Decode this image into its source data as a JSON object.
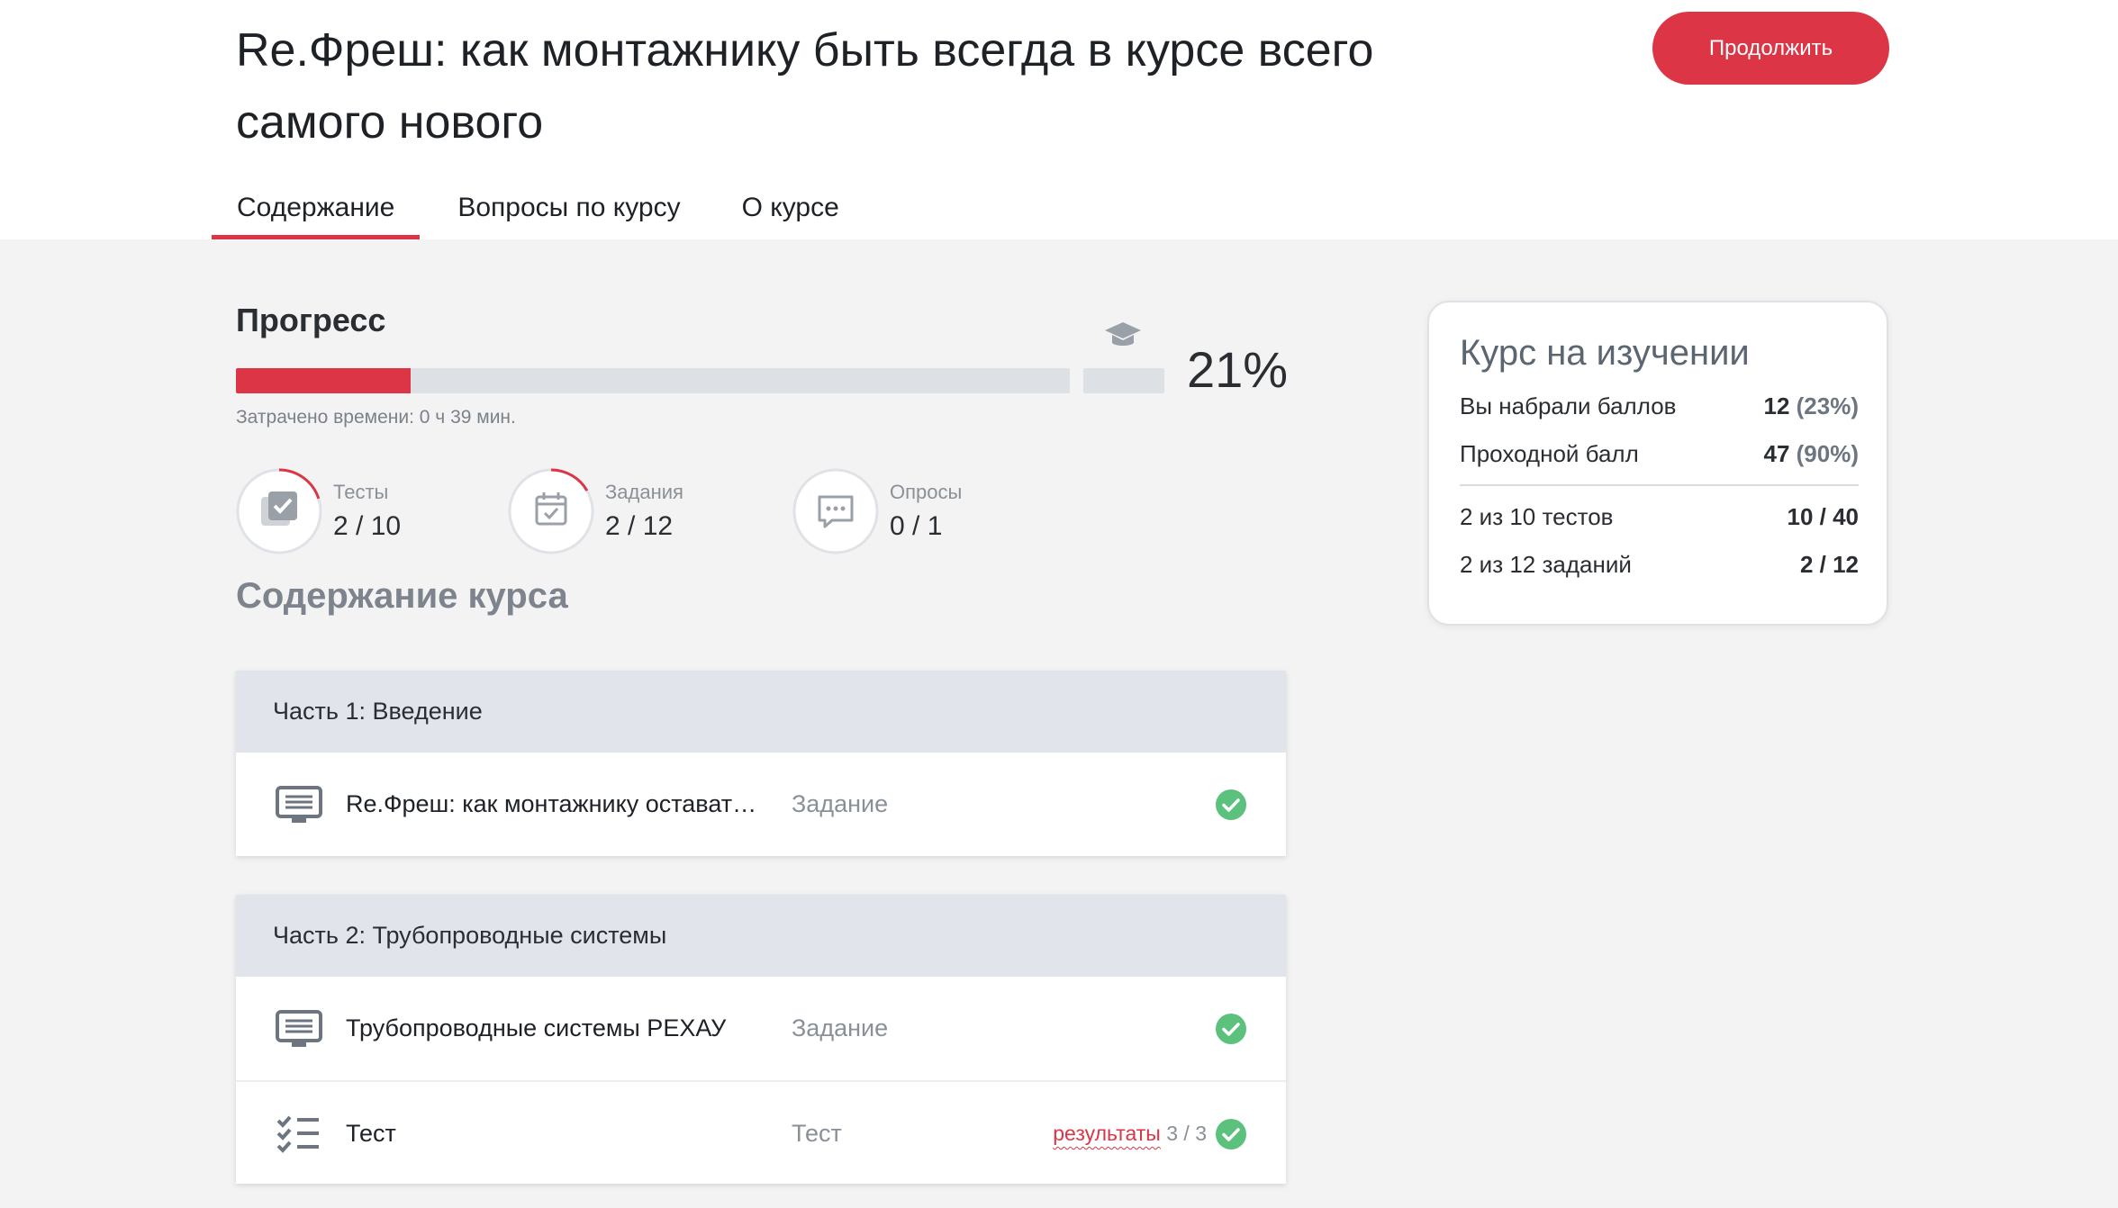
{
  "course": {
    "title": "Re.Фреш: как монтажнику быть всегда в курсе всего самого нового",
    "continue_label": "Продолжить"
  },
  "tabs": [
    {
      "label": "Содержание",
      "active": true
    },
    {
      "label": "Вопросы по курсу",
      "active": false
    },
    {
      "label": "О курсе",
      "active": false
    }
  ],
  "progress": {
    "title": "Прогресс",
    "percent": 21,
    "percent_label": "21%",
    "time_spent": "Затрачено времени: 0 ч 39 мин.",
    "icon": "graduation-cap-icon"
  },
  "stats": [
    {
      "label": "Тесты",
      "value": "2 / 10",
      "done": 2,
      "total": 10,
      "icon": "checkbox-icon"
    },
    {
      "label": "Задания",
      "value": "2 / 12",
      "done": 2,
      "total": 12,
      "icon": "calendar-check-icon"
    },
    {
      "label": "Опросы",
      "value": "0 / 1",
      "done": 0,
      "total": 1,
      "icon": "chat-icon"
    }
  ],
  "content": {
    "title": "Содержание курса",
    "sections": [
      {
        "title": "Часть 1: Введение",
        "items": [
          {
            "name": "Re.Фреш: как монтажнику оставаться всегда в курсе",
            "type": "Задание",
            "icon": "monitor-icon",
            "completed": true
          }
        ]
      },
      {
        "title": "Часть 2: Трубопроводные системы",
        "items": [
          {
            "name": "Трубопроводные системы РЕХАУ",
            "type": "Задание",
            "icon": "monitor-icon",
            "completed": true
          },
          {
            "name": "Тест",
            "type": "Тест",
            "icon": "checklist-icon",
            "completed": true,
            "results_label": "результаты",
            "results_score": "3 / 3"
          }
        ]
      }
    ]
  },
  "side_card": {
    "title": "Курс на изучении",
    "score_label": "Вы набрали баллов",
    "score_value": "12",
    "score_pct": "(23%)",
    "pass_label": "Проходной балл",
    "pass_value": "47",
    "pass_pct": "(90%)",
    "tests_label": "2 из 10 тестов",
    "tests_value": "10 / 40",
    "tasks_label": "2 из 12 заданий",
    "tasks_value": "2 / 12"
  },
  "colors": {
    "accent": "#dc3545",
    "success": "#5cc17c",
    "track": "#dde0e5"
  }
}
